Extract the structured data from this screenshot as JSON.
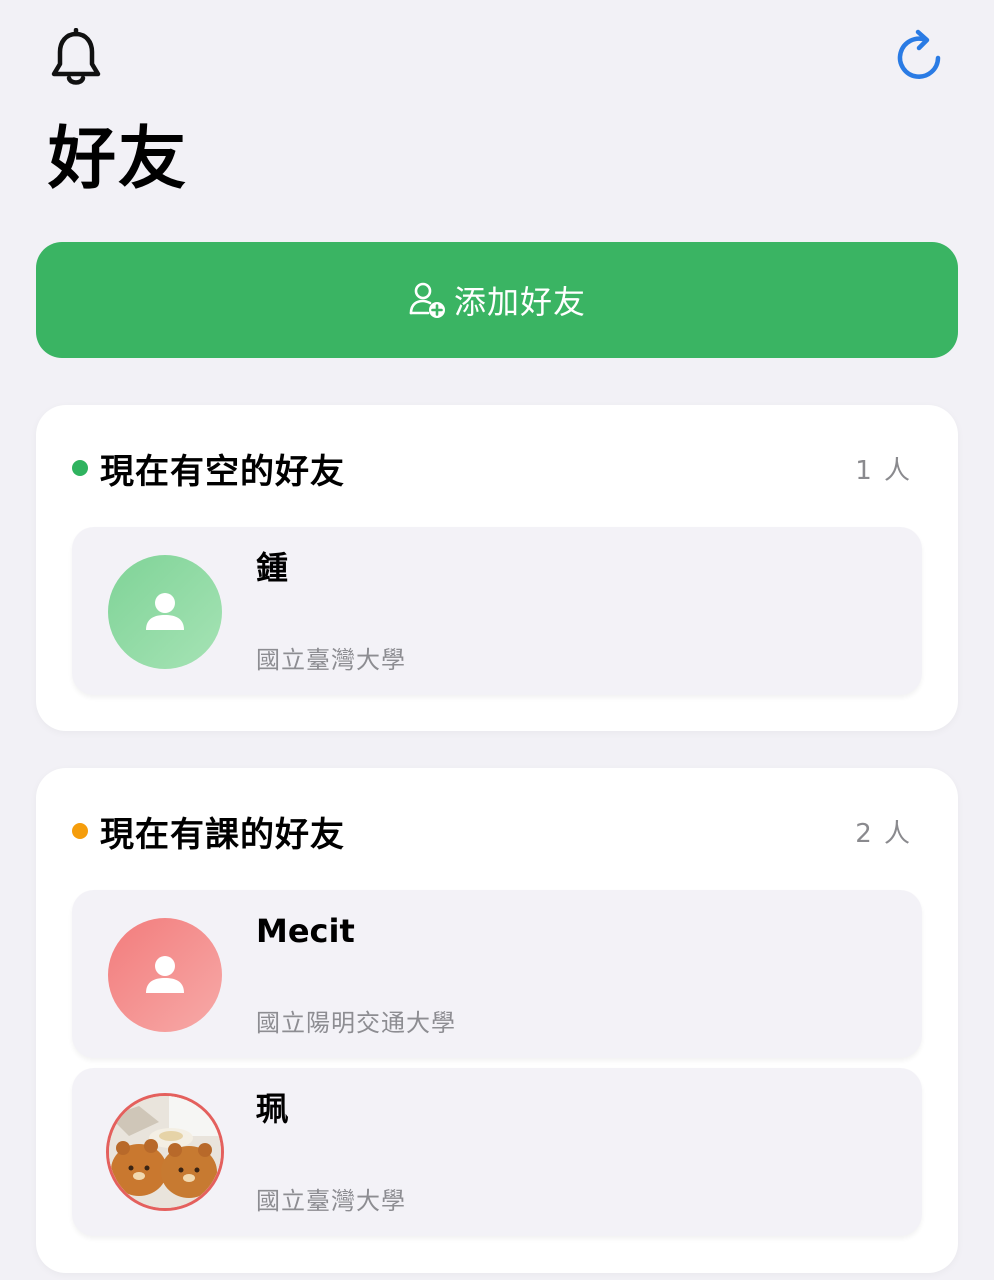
{
  "header": {
    "title": "好友",
    "notification_icon": "bell-icon",
    "refresh_icon": "refresh-icon",
    "accent_color": "#2a7be4"
  },
  "add_friend": {
    "label": "添加好友",
    "icon": "add-person-icon",
    "color": "#3ab463"
  },
  "sections": [
    {
      "title": "現在有空的好友",
      "count": "1 人",
      "dot_color": "#2fb35f",
      "friends": [
        {
          "name": "鍾",
          "school": "國立臺灣大學",
          "avatar": "default-person-icon"
        }
      ]
    },
    {
      "title": "現在有課的好友",
      "count": "2 人",
      "dot_color": "#f59d0c",
      "friends": [
        {
          "name": "Mecit",
          "school": "國立陽明交通大學",
          "avatar": "default-person-icon"
        },
        {
          "name": "珮",
          "school": "國立臺灣大學",
          "avatar": "photo-avatar"
        }
      ]
    }
  ]
}
